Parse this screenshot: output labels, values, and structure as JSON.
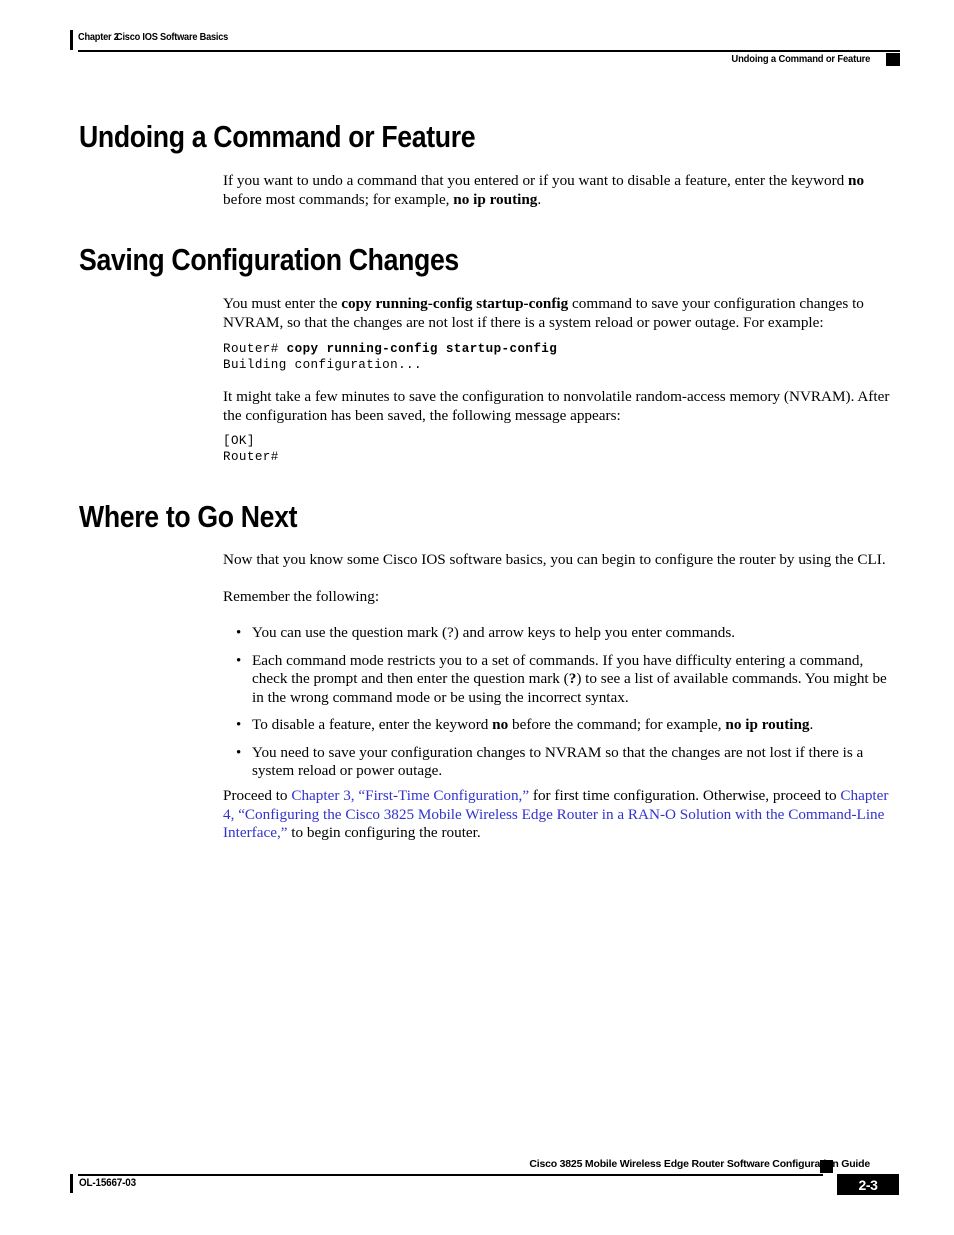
{
  "header": {
    "chapter_label": "Chapter 2",
    "chapter_title": "Cisco IOS Software Basics",
    "section_title": "Undoing a Command or Feature"
  },
  "sections": [
    {
      "heading": "Undoing a Command or Feature",
      "paragraph_1_part_1": "If you want to undo a command that you entered or if you want to disable a feature, enter the keyword ",
      "paragraph_1_bold_1": "no",
      "paragraph_1_part_2": " before most commands; for example, ",
      "paragraph_1_bold_2": "no ip routing",
      "paragraph_1_part_3": "."
    },
    {
      "heading": "Saving Configuration Changes",
      "paragraph_1_part_1": "You must enter the ",
      "paragraph_1_bold_1": "copy running-config startup-config",
      "paragraph_1_part_2": " command to save your configuration changes to NVRAM, so that the changes are not lost if there is a system reload or power outage. For example:",
      "code_block_1_prompt": "Router# ",
      "code_block_1_command": "copy running-config startup-config",
      "code_block_1_line_2": "Building configuration...",
      "paragraph_2": "It might take a few minutes to save the configuration to nonvolatile random-access memory (NVRAM). After the configuration has been saved, the following message appears:",
      "code_block_2_line_1": "[OK]",
      "code_block_2_line_2": "Router#"
    },
    {
      "heading": "Where to Go Next",
      "paragraph_1": "Now that you know some Cisco IOS software basics, you can begin to configure the router by using the CLI.",
      "paragraph_2": "Remember the following:",
      "bullets": [
        {
          "bullet_glyph": "•",
          "part_1": "You can use the question mark (?) and arrow keys to help you enter commands."
        },
        {
          "bullet_glyph": "•",
          "part_1": "Each command mode restricts you to a set of commands. If you have difficulty entering a command, check the prompt and then enter the question mark (",
          "bold_1": "?",
          "part_2": ") to see a list of available commands. You might be in the wrong command mode or be using the incorrect syntax."
        },
        {
          "bullet_glyph": "•",
          "part_1": "To disable a feature, enter the keyword ",
          "bold_1": "no",
          "part_2": " before the command; for example, ",
          "bold_2": "no ip routing",
          "part_3": "."
        },
        {
          "bullet_glyph": "•",
          "part_1": "You need to save your configuration changes to NVRAM so that the changes are not lost if there is a system reload or power outage."
        }
      ],
      "closing_paragraph": {
        "part_1": "Proceed to ",
        "link_1": "Chapter 3, “First-Time Configuration,”",
        "part_2": " for first time configuration. Otherwise, proceed to ",
        "link_2": "Chapter 4, “Configuring the Cisco 3825 Mobile Wireless Edge Router in a RAN-O Solution with the Command-Line Interface,”",
        "part_3": " to begin configuring the router."
      }
    }
  ],
  "footer": {
    "document_id": "OL-15667-03",
    "guide_title": "Cisco 3825 Mobile Wireless Edge Router Software Configuration Guide",
    "page_number": "2-3"
  },
  "colors": {
    "link": "#3333cc",
    "text": "#000000",
    "rule": "#000000"
  }
}
